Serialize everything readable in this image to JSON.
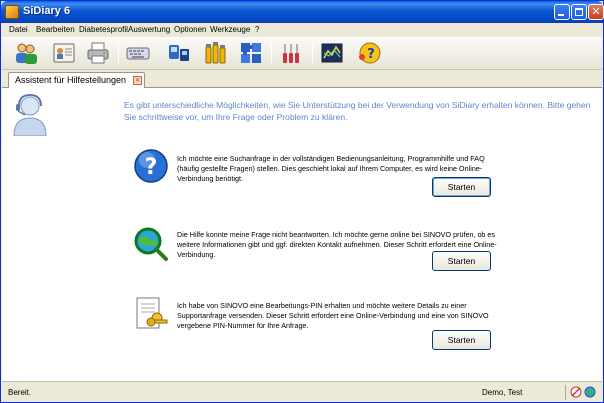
{
  "window": {
    "title": "SiDiary 6"
  },
  "menu": [
    {
      "label": "Datei",
      "key": "D"
    },
    {
      "label": "Bearbeiten",
      "key": "B"
    },
    {
      "label": "Diabetesprofil",
      "key": "p"
    },
    {
      "label": "Auswertung",
      "key": "A"
    },
    {
      "label": "Optionen",
      "key": "O"
    },
    {
      "label": "Werkzeuge",
      "key": "W"
    },
    {
      "label": "?",
      "key": "?"
    }
  ],
  "toolbar": {
    "icons": [
      "persons-icon",
      "id-card-icon",
      "printer-icon",
      "keyboard-icon",
      "device-transfer-icon",
      "bottles-icon",
      "puzzle-icon",
      "cutlery-icon",
      "chart-icon",
      "help-face-icon"
    ]
  },
  "tab": {
    "label": "Assistent für Hilfestellungen",
    "close": "×"
  },
  "intro": "Es gibt unterschiedliche Möglichkeiten, wie Sie Unterstützung bei der Verwendung von SiDiary erhalten können. Bitte gehen Sie schrittweise vor, um Ihre Frage oder Problem zu klären.",
  "options": [
    {
      "text": "Ich möchte eine Suchanfrage in der vollständigen Bedienungsanleitung, Programmhilfe und FAQ (häufig gestellte Fragen) stellen. Dies geschieht lokal auf Ihrem Computer, es wird keine Online-Verbindung benötigt.",
      "button": "Starten",
      "icon": "question-icon"
    },
    {
      "text": "Die Hilfe konnte meine Frage nicht beantworten. Ich möchte gerne online bei SINOVO prüfen, ob es weitere Informationen gibt und ggf. direkten Kontakt aufnehmen. Dieser Schritt erfordert eine Online-Verbindung.",
      "button": "Starten",
      "icon": "globe-search-icon"
    },
    {
      "text": "Ich habe von SINOVO eine Bearbeitungs-PIN erhalten und möchte weitere Details zu einer Supportanfrage versenden. Dieser Schritt erfordert eine Online-Verbindung und eine von SINOVO vergebene PIN-Nummer für Ihre Anfrage.",
      "button": "Starten",
      "icon": "document-keys-icon"
    }
  ],
  "status": {
    "left": "Bereit.",
    "user": "Demo, Test"
  },
  "colors": {
    "titlebar": "#0a57d4",
    "intro_text": "#5e87c8",
    "window_bg": "#ece9d8"
  }
}
